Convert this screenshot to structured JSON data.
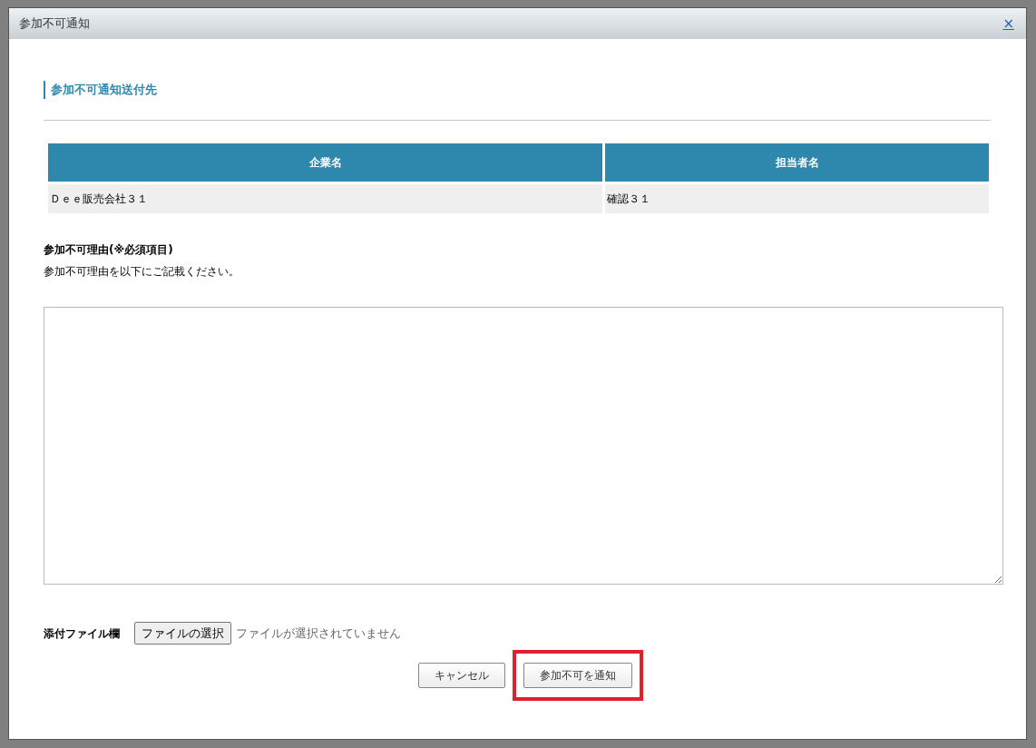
{
  "dialog": {
    "title": "参加不可通知",
    "close": "×"
  },
  "section": {
    "heading": "参加不可通知送付先"
  },
  "table": {
    "columns": [
      "企業名",
      "担当者名"
    ],
    "rows": [
      [
        "Ｄｅｅ販売会社３１",
        "確認３１"
      ]
    ]
  },
  "reason": {
    "label": "参加不可理由(※必須項目)",
    "hint": "参加不可理由を以下にご記載ください。"
  },
  "attachment": {
    "label": "添付ファイル欄",
    "button": "ファイルの選択",
    "status": "ファイルが選択されていません"
  },
  "buttons": [
    {
      "label": "キャンセル",
      "highlighted": false
    },
    {
      "label": "参加不可を通知",
      "highlighted": true
    }
  ]
}
